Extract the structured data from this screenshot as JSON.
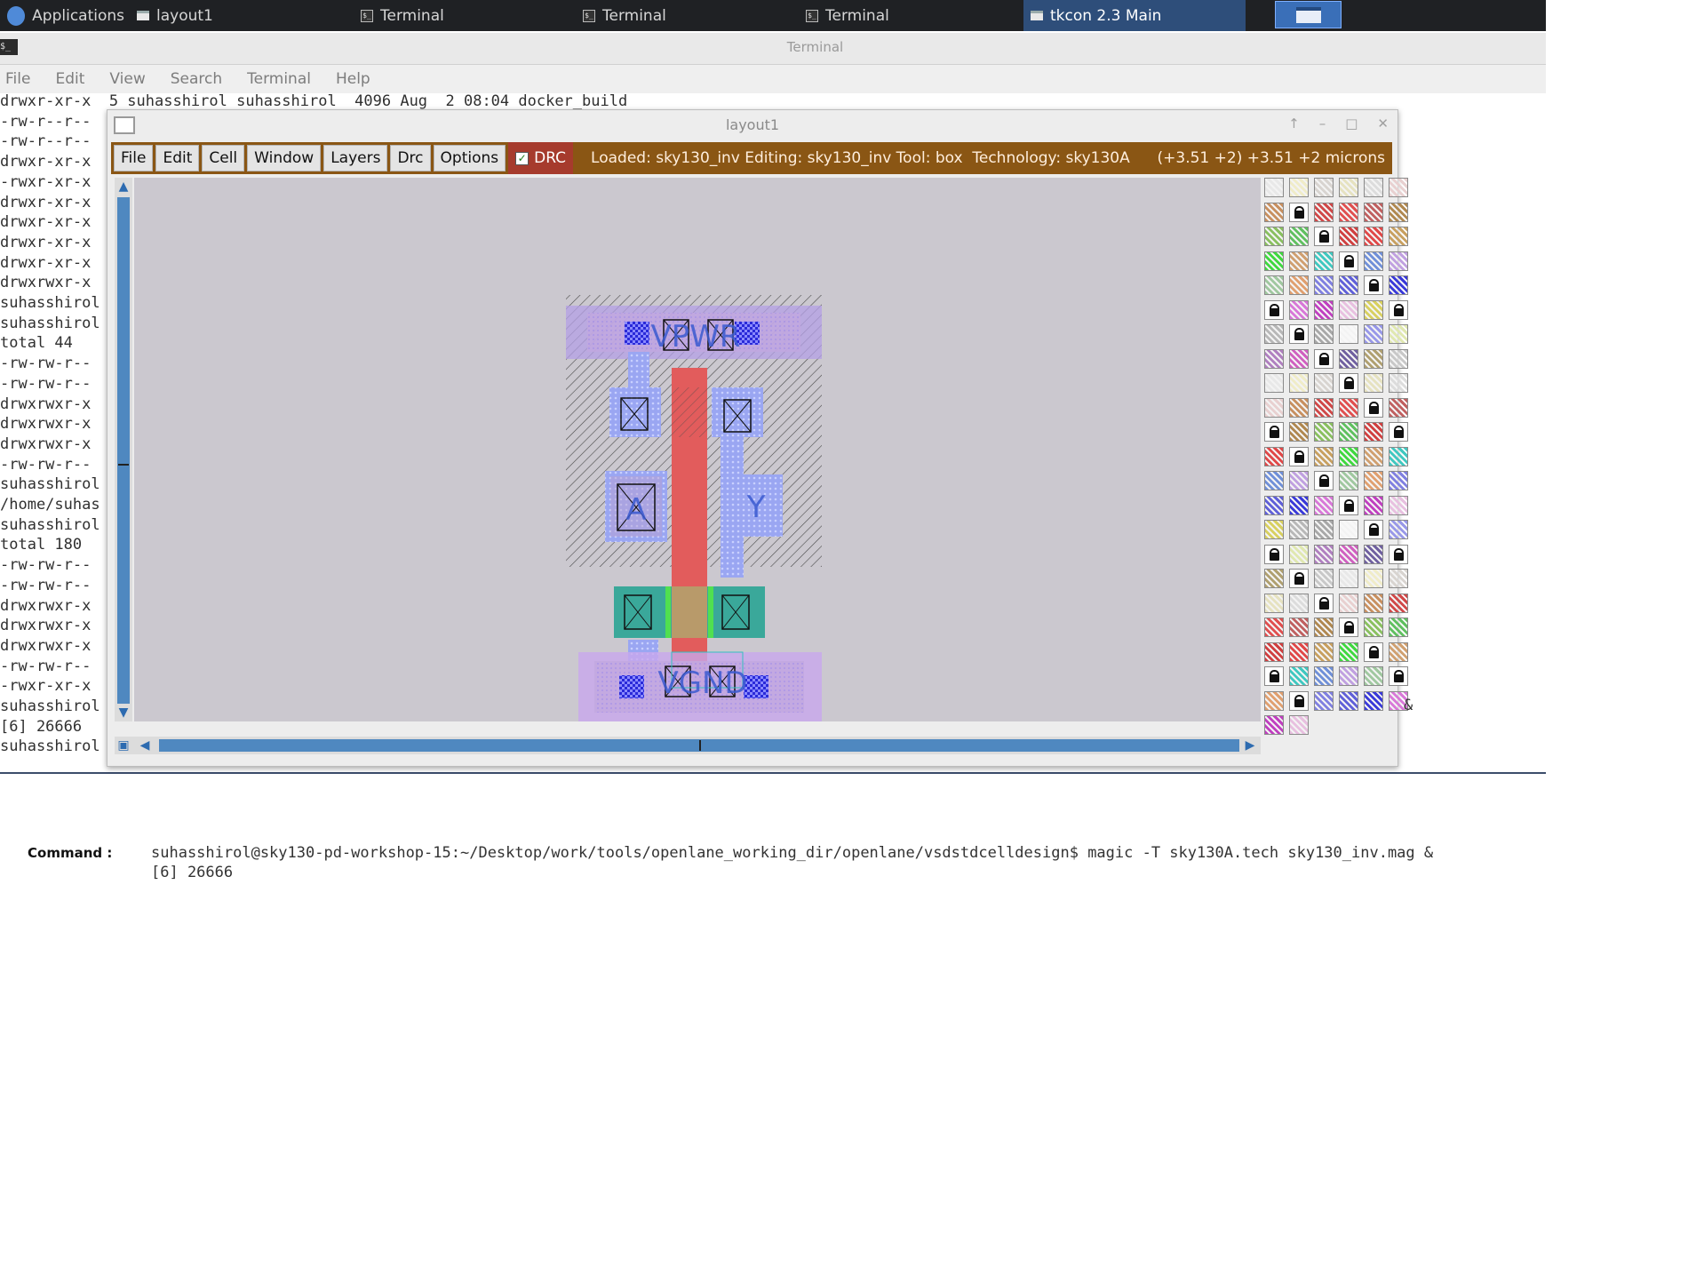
{
  "taskbar": {
    "apps_label": "Applications",
    "items": [
      {
        "label": "layout1",
        "icon": "window-icon"
      },
      {
        "label": "Terminal",
        "icon": "terminal-icon"
      },
      {
        "label": "Terminal",
        "icon": "terminal-icon"
      },
      {
        "label": "Terminal",
        "icon": "terminal-icon"
      },
      {
        "label": "tkcon 2.3 Main",
        "icon": "window-icon",
        "active": true
      }
    ]
  },
  "terminal": {
    "title": "Terminal",
    "menu": [
      "File",
      "Edit",
      "View",
      "Search",
      "Terminal",
      "Help"
    ],
    "lines": [
      "drwxr-xr-x  5 suhasshirol suhasshirol  4096 Aug  2 08:04 docker_build",
      "-rw-r--r--",
      "-rw-r--r--",
      "drwxr-xr-x",
      "-rwxr-xr-x",
      "drwxr-xr-x",
      "drwxr-xr-x",
      "drwxr-xr-x",
      "drwxr-xr-x",
      "drwxrwxr-x",
      "suhasshirol",
      "suhasshirol",
      "total 44",
      "-rw-rw-r--",
      "-rw-rw-r--",
      "drwxrwxr-x",
      "drwxrwxr-x",
      "drwxrwxr-x",
      "-rw-rw-r--",
      "suhasshirol",
      "/home/suhas",
      "suhasshirol",
      "total 180",
      "-rw-rw-r--",
      "-rw-rw-r--",
      "drwxrwxr-x",
      "drwxrwxr-x",
      "drwxrwxr-x",
      "-rw-rw-r--",
      "-rwxr-xr-x",
      "suhasshirol",
      "[6] 26666",
      "suhasshirol"
    ]
  },
  "magic": {
    "title": "layout1",
    "menu": [
      "File",
      "Edit",
      "Cell",
      "Window",
      "Layers",
      "Drc",
      "Options"
    ],
    "drc_label": "DRC",
    "drc_checked": true,
    "status": "Loaded: sky130_inv Editing: sky130_inv Tool: box  Technology: sky130A",
    "coords": "(+3.51 +2) +3.51 +2 microns",
    "labels": {
      "vpwr": "VPWR",
      "vgnd": "VGND",
      "input": "A",
      "output": "Y"
    },
    "colors": {
      "menubar": "#8a5614",
      "drc_button": "#a63b2d",
      "poly": "#e05a5a",
      "diffusion": "#3fb0a0",
      "local_interconnect": "#a0a8ff",
      "metal": "#c8a8e8",
      "nwell_hatch": "#555555"
    }
  },
  "command": {
    "label": "Command :",
    "line1": "suhasshirol@sky130-pd-workshop-15:~/Desktop/work/tools/openlane_working_dir/openlane/vsdstdcelldesign$ magic -T sky130A.tech sky130_inv.mag &",
    "line2": "[6] 26666",
    "trailing": "&"
  }
}
